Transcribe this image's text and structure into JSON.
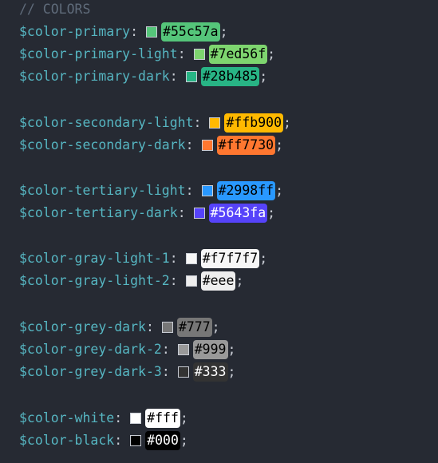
{
  "editor": {
    "comment": "// COLORS",
    "lines": [
      {
        "name": "$color-primary",
        "value": "#55c57a",
        "bg": "#55c57a",
        "fg": "#000000"
      },
      {
        "name": "$color-primary-light",
        "value": "#7ed56f",
        "bg": "#7ed56f",
        "fg": "#000000"
      },
      {
        "name": "$color-primary-dark",
        "value": "#28b485",
        "bg": "#28b485",
        "fg": "#000000"
      },
      {
        "name": "$color-secondary-light",
        "value": "#ffb900",
        "bg": "#ffb900",
        "fg": "#000000"
      },
      {
        "name": "$color-secondary-dark",
        "value": "#ff7730",
        "bg": "#ff7730",
        "fg": "#000000"
      },
      {
        "name": "$color-tertiary-light",
        "value": "#2998ff",
        "bg": "#2998ff",
        "fg": "#000000"
      },
      {
        "name": "$color-tertiary-dark",
        "value": "#5643fa",
        "bg": "#5643fa",
        "fg": "#ffffff"
      },
      {
        "name": "$color-gray-light-1",
        "value": "#f7f7f7",
        "bg": "#f7f7f7",
        "fg": "#000000"
      },
      {
        "name": "$color-gray-light-2",
        "value": "#eee",
        "bg": "#eeeeee",
        "fg": "#000000"
      },
      {
        "name": "$color-grey-dark",
        "value": "#777",
        "bg": "#777777",
        "fg": "#000000"
      },
      {
        "name": "$color-grey-dark-2",
        "value": "#999",
        "bg": "#999999",
        "fg": "#000000"
      },
      {
        "name": "$color-grey-dark-3",
        "value": "#333",
        "bg": "#333333",
        "fg": "#ffffff"
      },
      {
        "name": "$color-white",
        "value": "#fff",
        "bg": "#ffffff",
        "fg": "#000000"
      },
      {
        "name": "$color-black",
        "value": "#000",
        "bg": "#000000",
        "fg": "#ffffff"
      }
    ]
  }
}
